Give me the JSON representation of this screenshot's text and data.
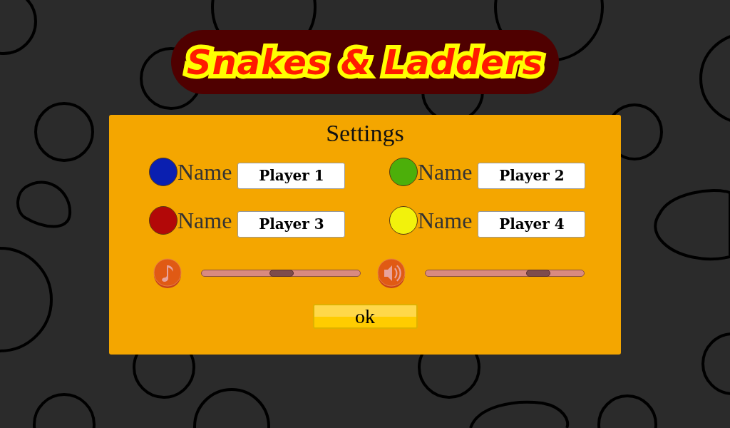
{
  "title": "Snakes & Ladders",
  "dialog": {
    "title": "Settings",
    "players": [
      {
        "label": "Name",
        "value": "Player 1",
        "color": "#0a1fb0"
      },
      {
        "label": "Name",
        "value": "Player 2",
        "color": "#4caf0a"
      },
      {
        "label": "Name",
        "value": "Player 3",
        "color": "#b20808"
      },
      {
        "label": "Name",
        "value": "Player 4",
        "color": "#f2f20c"
      }
    ],
    "volume": [
      {
        "kind": "music",
        "level": 0.5
      },
      {
        "kind": "sound",
        "level": 0.74
      }
    ],
    "ok_button": "ok"
  }
}
